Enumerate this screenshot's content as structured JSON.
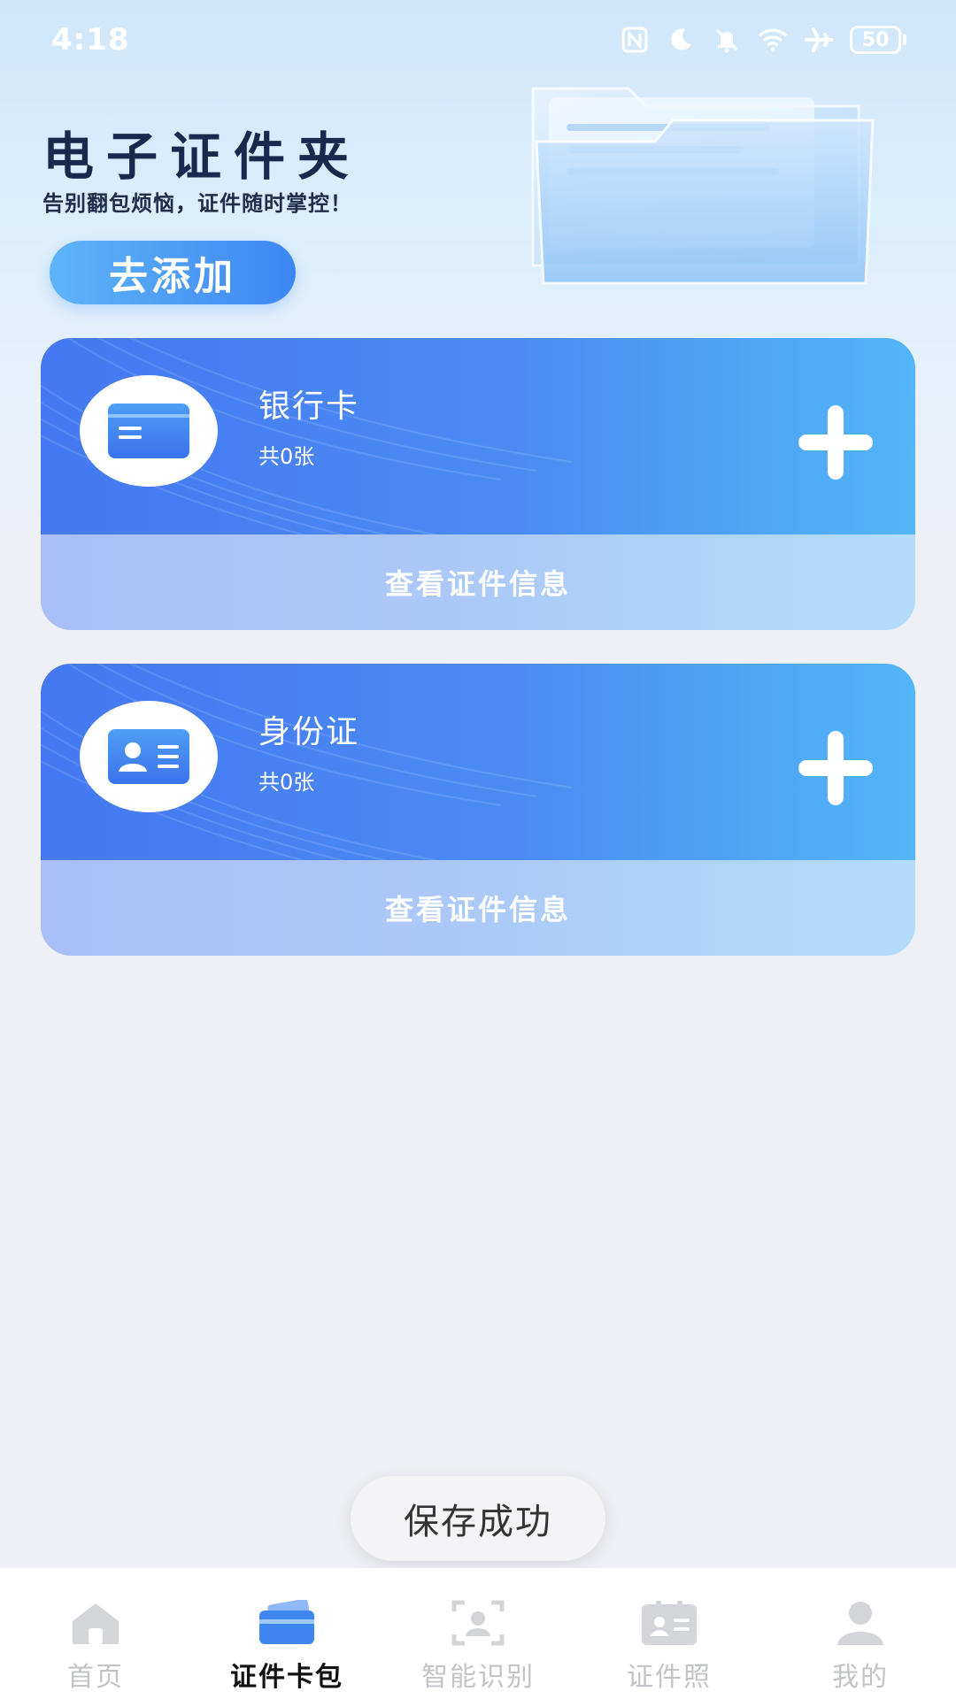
{
  "status_bar": {
    "time": "4:18",
    "battery": "50",
    "icons": [
      "nfc-icon",
      "moon-icon",
      "bell-muted-icon",
      "wifi-icon",
      "airplane-icon",
      "battery-icon"
    ]
  },
  "header": {
    "title": "电子证件夹",
    "subtitle": "告别翻包烦恼，证件随时掌控！",
    "add_button": "去添加"
  },
  "cards": [
    {
      "name": "银行卡",
      "count": "共0张",
      "view_label": "查看证件信息",
      "icon": "bank-card-icon"
    },
    {
      "name": "身份证",
      "count": "共0张",
      "view_label": "查看证件信息",
      "icon": "id-card-icon"
    }
  ],
  "toast": "保存成功",
  "tabbar": {
    "active": 1,
    "items": [
      {
        "label": "首页",
        "icon": "home-icon"
      },
      {
        "label": "证件卡包",
        "icon": "card-wallet-icon"
      },
      {
        "label": "智能识别",
        "icon": "scan-portrait-icon"
      },
      {
        "label": "证件照",
        "icon": "id-photo-icon"
      },
      {
        "label": "我的",
        "icon": "user-icon"
      }
    ]
  },
  "colors": {
    "accent": "#4a8cf3",
    "card_gradient_start": "#4578f1",
    "card_gradient_end": "#53b6f8",
    "title": "#17294d",
    "tab_inactive": "#c2c4c8"
  }
}
